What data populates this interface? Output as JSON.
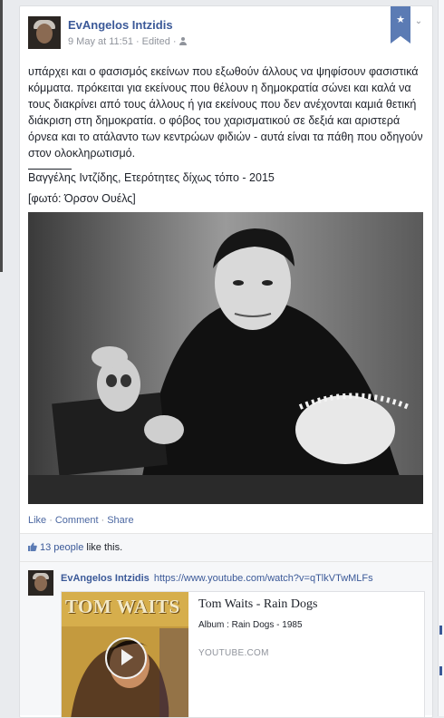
{
  "post": {
    "author": "EvAngelos Intzidis",
    "date": "9 May at 11:51",
    "edited": "Edited",
    "meta_separator": "·",
    "body": "υπάρχει και ο φασισμός εκείνων που εξωθούν άλλους να ψηφίσουν φασιστικά κόμματα. πρόκειται για εκείνους που θέλουν η δημοκρατία σώνει και καλά να τους διακρίνει από τους άλλους ή για εκείνους που δεν ανέχονται καμιά θετική διάκριση στη δημοκρατία. ο φόβος του χαρισματικού σε δεξιά και αριστερά όρνεα και το ατάλαντο των κεντρώων φιδιών - αυτά είναι τα πάθη που οδηγούν στον ολοκληρωτισμό.",
    "signature": "Βαγγέλης Ιντζίδης, Ετερότητες δίχως τόπο - 2015",
    "photo_credit": "[φωτό: Όρσον Ουέλς]",
    "star_glyph": "★",
    "chevron_glyph": "⌄"
  },
  "actions": {
    "like": "Like",
    "comment": "Comment",
    "share": "Share",
    "separator": "·"
  },
  "likes": {
    "count_label": "13 people",
    "suffix": "like this."
  },
  "comment": {
    "author": "EvAngelos Intzidis",
    "url": "https://www.youtube.com/watch?v=qTlkVTwMLFs",
    "preview": {
      "thumbnail_text": "TOM WAITS",
      "title": "Tom Waits - Rain Dogs",
      "subtitle": "Album : Rain Dogs - 1985",
      "domain": "YOUTUBE.COM"
    }
  },
  "colors": {
    "link": "#3b5998",
    "ribbon": "#5b7bb4",
    "meta": "#90949c"
  },
  "icons": [
    "star-icon",
    "chevron-down-icon",
    "audience-icon",
    "like-thumb-icon",
    "play-icon"
  ]
}
